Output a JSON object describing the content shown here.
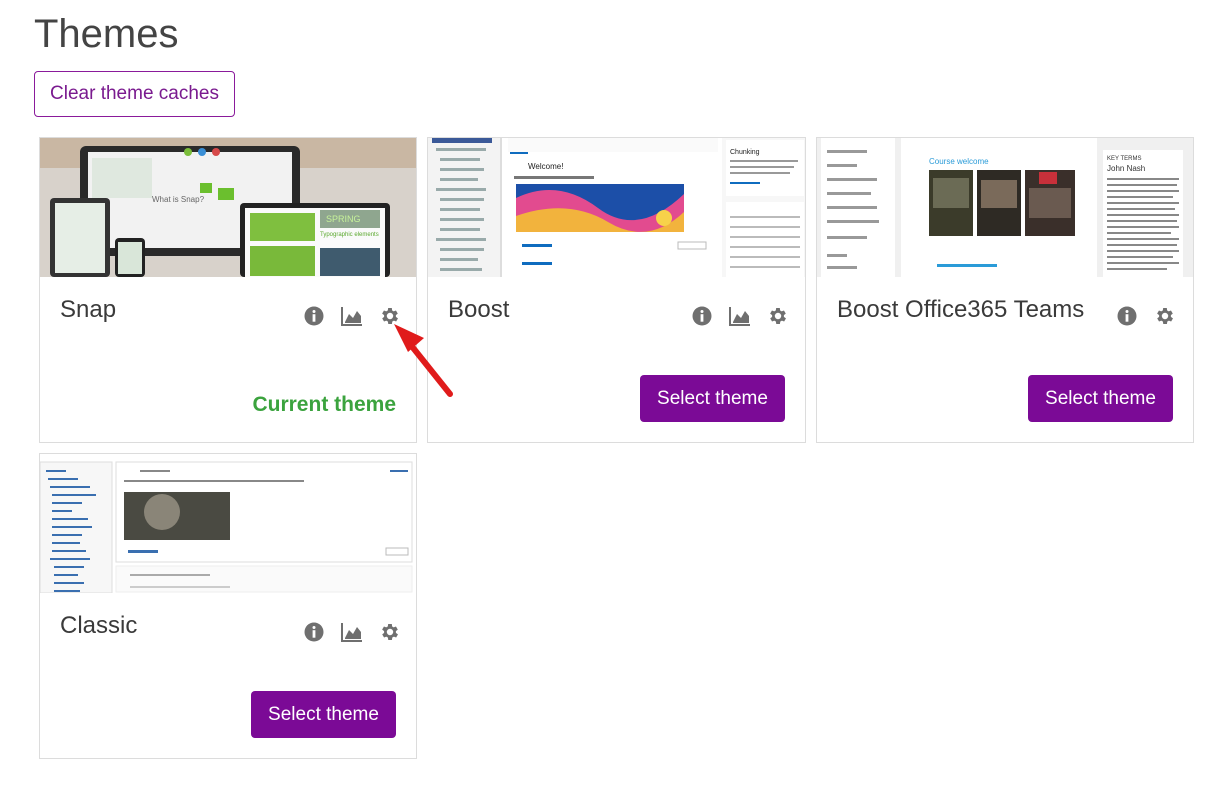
{
  "page": {
    "title": "Themes"
  },
  "actions": {
    "clear_caches_label": "Clear theme caches"
  },
  "themes": [
    {
      "name": "Snap",
      "status": "Current theme",
      "is_current": true
    },
    {
      "name": "Boost",
      "select_label": "Select theme"
    },
    {
      "name": "Boost Office365 Teams",
      "select_label": "Select theme"
    },
    {
      "name": "Classic",
      "select_label": "Select theme"
    }
  ],
  "icons": [
    "info-icon",
    "chart-icon",
    "gear-icon"
  ],
  "colors": {
    "accent": "#7b0a96",
    "current": "#3ba33e",
    "icon": "#6f6f6f",
    "arrow": "#e01b1b"
  }
}
